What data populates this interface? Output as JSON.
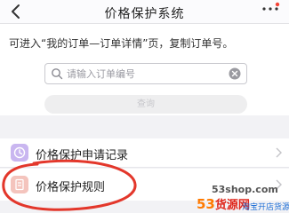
{
  "nav": {
    "title": "价格保护系统"
  },
  "search": {
    "hint": "可进入“我的订单—订单详情”页，复制订单号。",
    "placeholder": "请输入订单编号",
    "value": "",
    "query_button": "查询"
  },
  "menu": {
    "items": [
      {
        "label": "价格保护申请记录",
        "icon": "clock-icon",
        "color": "#c9b6f0"
      },
      {
        "label": "价格保护规则",
        "icon": "document-icon",
        "color": "#f4c4bd"
      }
    ]
  },
  "annotation": {
    "color": "#e3372b"
  },
  "watermark": {
    "domain": "53shop.com",
    "logo_digits": "53",
    "logo_name": "货源网",
    "sub": "淘宝开店货源"
  }
}
